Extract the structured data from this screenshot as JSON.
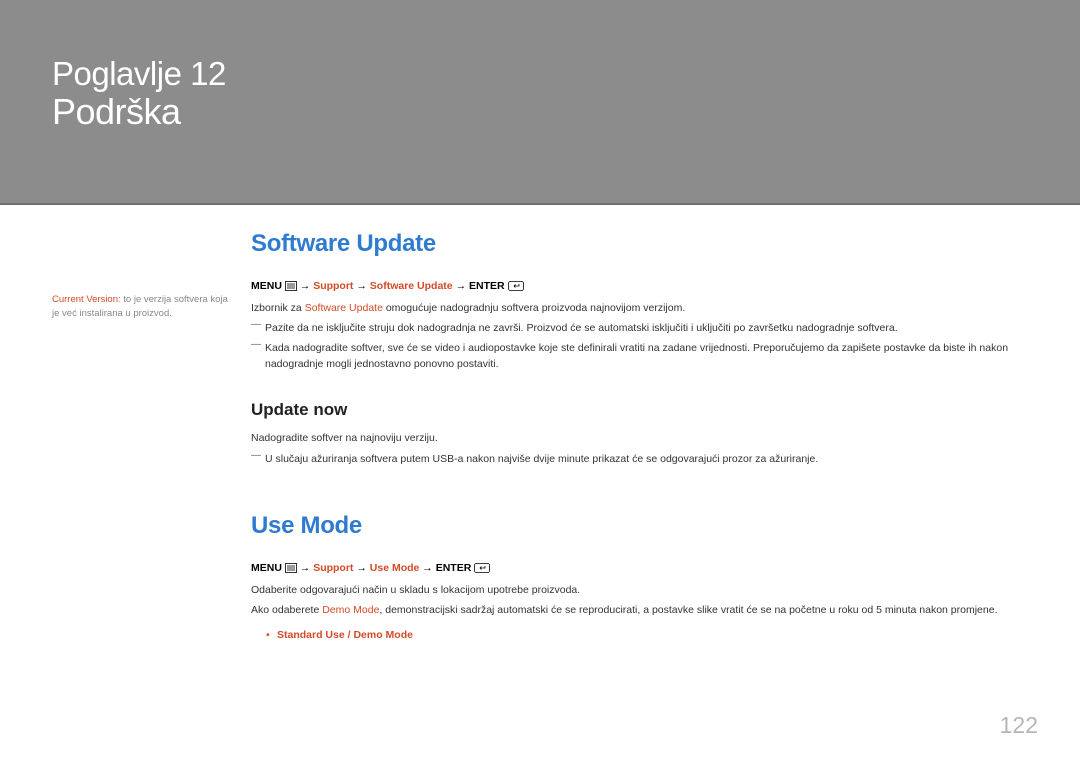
{
  "chapter": {
    "label": "Poglavlje",
    "number": "12",
    "title": "Podrška"
  },
  "sidebar_note": {
    "highlight": "Current Version",
    "text": ": to je verzija softvera koja je već instalirana u proizvod."
  },
  "section1": {
    "heading": "Software Update",
    "path": {
      "menu": "MENU",
      "p1": "Support",
      "p2": "Software Update",
      "enter": "ENTER"
    },
    "intro_pre": "Izbornik za ",
    "intro_hl": "Software Update",
    "intro_post": " omogućuje nadogradnju softvera proizvoda najnovijom verzijom.",
    "note1": "Pazite da ne isključite struju dok nadogradnja ne završi. Proizvod će se automatski isključiti i uključiti po završetku nadogradnje softvera.",
    "note2": "Kada nadogradite softver, sve će se video i audiopostavke koje ste definirali vratiti na zadane vrijednosti. Preporučujemo da zapišete postavke da biste ih nakon nadogradnje mogli jednostavno ponovno postaviti.",
    "sub": {
      "heading": "Update now",
      "text": "Nadogradite softver na najnoviju verziju.",
      "note": "U slučaju ažuriranja softvera putem USB-a nakon najviše dvije minute prikazat će se odgovarajući prozor za ažuriranje."
    }
  },
  "section2": {
    "heading": "Use Mode",
    "path": {
      "menu": "MENU",
      "p1": "Support",
      "p2": "Use Mode",
      "enter": "ENTER"
    },
    "text1": "Odaberite odgovarajući način u skladu s lokacijom upotrebe proizvoda.",
    "text2_pre": "Ako odaberete ",
    "text2_hl": "Demo Mode",
    "text2_post": ", demonstracijski sadržaj automatski će se reproducirati, a postavke slike vratit će se na početne u roku od 5 minuta nakon promjene.",
    "bullet": "Standard Use / Demo Mode"
  },
  "page_number": "122",
  "arrow": "→"
}
